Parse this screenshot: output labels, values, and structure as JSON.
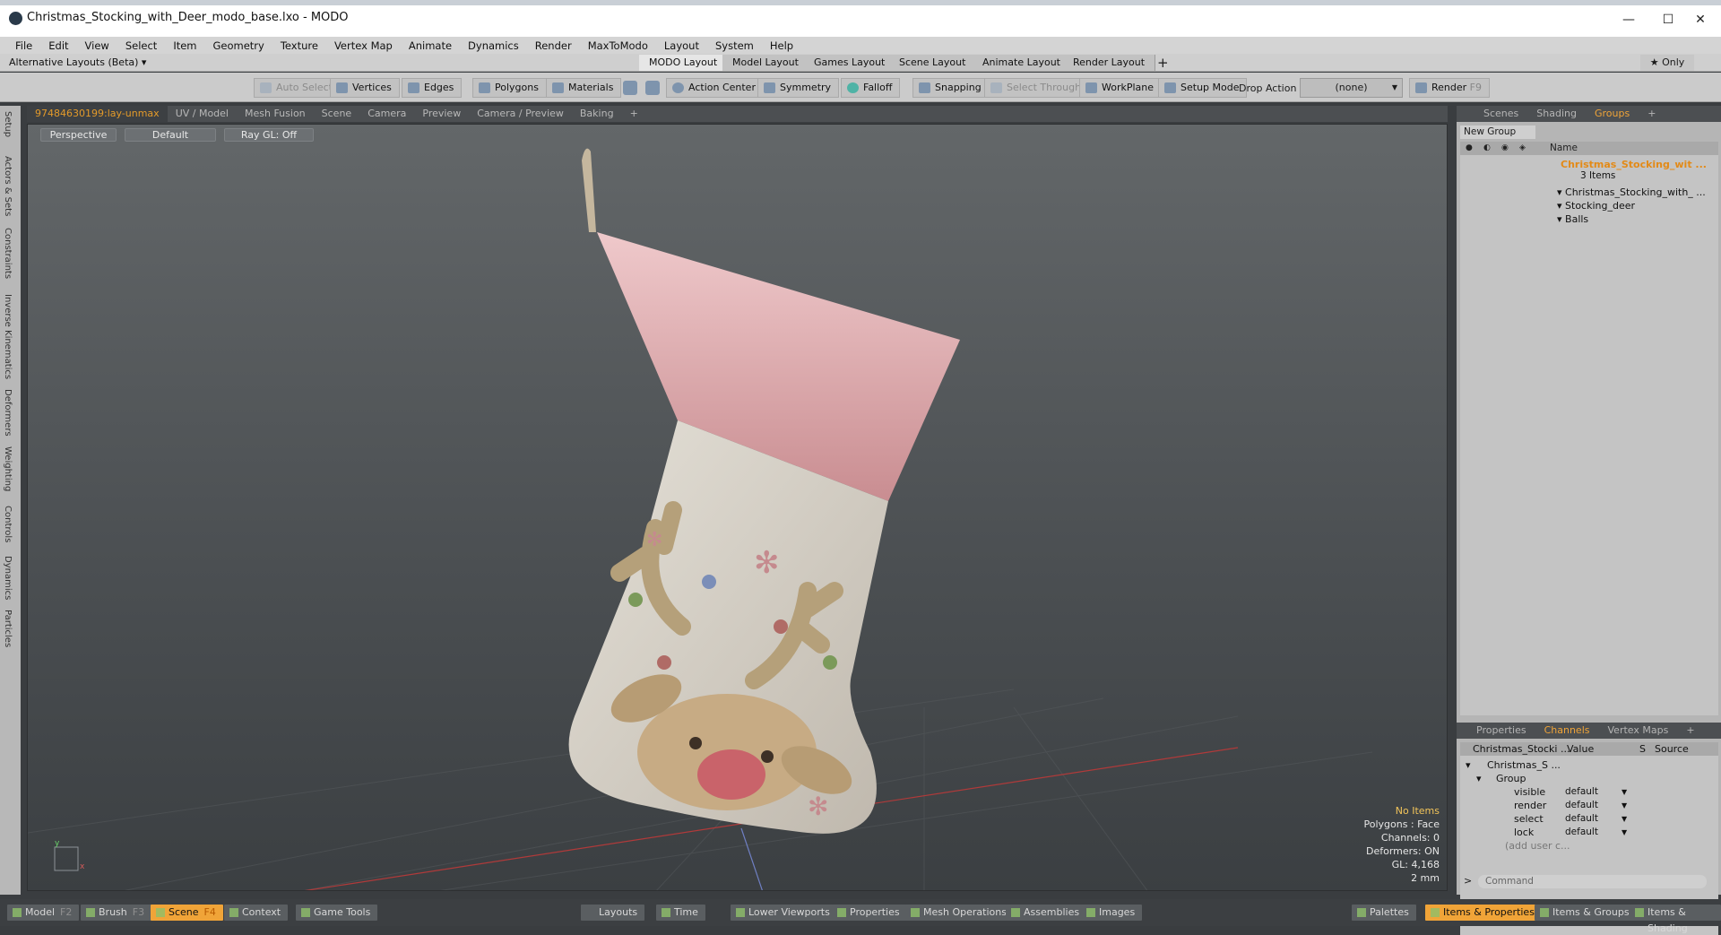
{
  "window": {
    "title": "Christmas_Stocking_with_Deer_modo_base.lxo - MODO",
    "minimize": "—",
    "maximize": "☐",
    "close": "✕"
  },
  "menu": [
    "File",
    "Edit",
    "View",
    "Select",
    "Item",
    "Geometry",
    "Texture",
    "Vertex Map",
    "Animate",
    "Dynamics",
    "Render",
    "MaxToModo",
    "Layout",
    "System",
    "Help"
  ],
  "layouts": {
    "alt_layout": "Alternative Layouts (Beta) ▾",
    "tabs": [
      "MODO Layout",
      "Model Layout",
      "Games Layout",
      "Scene Layout",
      "Animate Layout",
      "Render Layout"
    ],
    "add": "+",
    "only": "★ Only"
  },
  "toolbar": {
    "auto_select": "Auto Select",
    "vertices": "Vertices",
    "edges": "Edges",
    "polygons": "Polygons",
    "materials": "Materials",
    "action_center": "Action Center",
    "symmetry": "Symmetry",
    "falloff": "Falloff",
    "snapping": "Snapping",
    "select_through": "Select Through",
    "workplane": "WorkPlane",
    "setup_mode": "Setup Mode",
    "drop_action": "Drop Action",
    "drop_value": "(none)",
    "render": "Render",
    "render_key": "F9"
  },
  "viewport_tabs": [
    "97484630199:lay-unmax",
    "UV / Model",
    "Mesh Fusion",
    "Scene",
    "Camera",
    "Preview",
    "Camera / Preview",
    "Baking",
    "+"
  ],
  "viewport": {
    "perspective": "Perspective",
    "shading": "Default",
    "raygl": "Ray GL: Off",
    "hud": {
      "no_items": "No Items",
      "polygons": "Polygons : Face",
      "channels": "Channels: 0",
      "deformers": "Deformers: ON",
      "gl": "GL: 4,168",
      "scale": "2 mm"
    }
  },
  "left_tabs": [
    "Setup",
    "Actors & Sets",
    "Constraints",
    "Inverse Kinematics",
    "Deformers",
    "Weighting",
    "Controls",
    "Dynamics",
    "Particles"
  ],
  "right_panel": {
    "tabs": [
      "Scenes",
      "Shading",
      "Groups",
      "+"
    ],
    "new_group": "New Group",
    "name_col": "Name",
    "group_name": "Christmas_Stocking_wit ...",
    "item_count": "3 Items",
    "children": [
      "Christmas_Stocking_with_ ...",
      "Stocking_deer",
      "Balls"
    ]
  },
  "channels": {
    "tabs": [
      "Properties",
      "Channels",
      "Vertex Maps",
      "+"
    ],
    "col_name": "Christmas_Stocki ...",
    "col_value": "Value",
    "col_s": "S",
    "col_source": "Source",
    "root": "Christmas_S ...",
    "group": "Group",
    "rows": [
      {
        "name": "visible",
        "value": "default"
      },
      {
        "name": "render",
        "value": "default"
      },
      {
        "name": "select",
        "value": "default"
      },
      {
        "name": "lock",
        "value": "default"
      }
    ],
    "add_user": "(add user c...",
    "command_placeholder": "Command"
  },
  "bottom": {
    "model": "Model",
    "model_key": "F2",
    "brush": "Brush",
    "brush_key": "F3",
    "scene": "Scene",
    "scene_key": "F4",
    "context": "Context",
    "game_tools": "Game Tools",
    "layouts": "Layouts",
    "time": "Time",
    "lower_viewports": "Lower Viewports",
    "properties": "Properties",
    "mesh_ops": "Mesh Operations",
    "assemblies": "Assemblies",
    "images": "Images",
    "palettes": "Palettes",
    "items_props": "Items & Properties",
    "items_groups": "Items & Groups",
    "items_shading": "Items & Shading"
  },
  "colors": {
    "accent": "#f0a438",
    "viewport_top": "#636769",
    "viewport_bottom": "#3b3f42"
  }
}
